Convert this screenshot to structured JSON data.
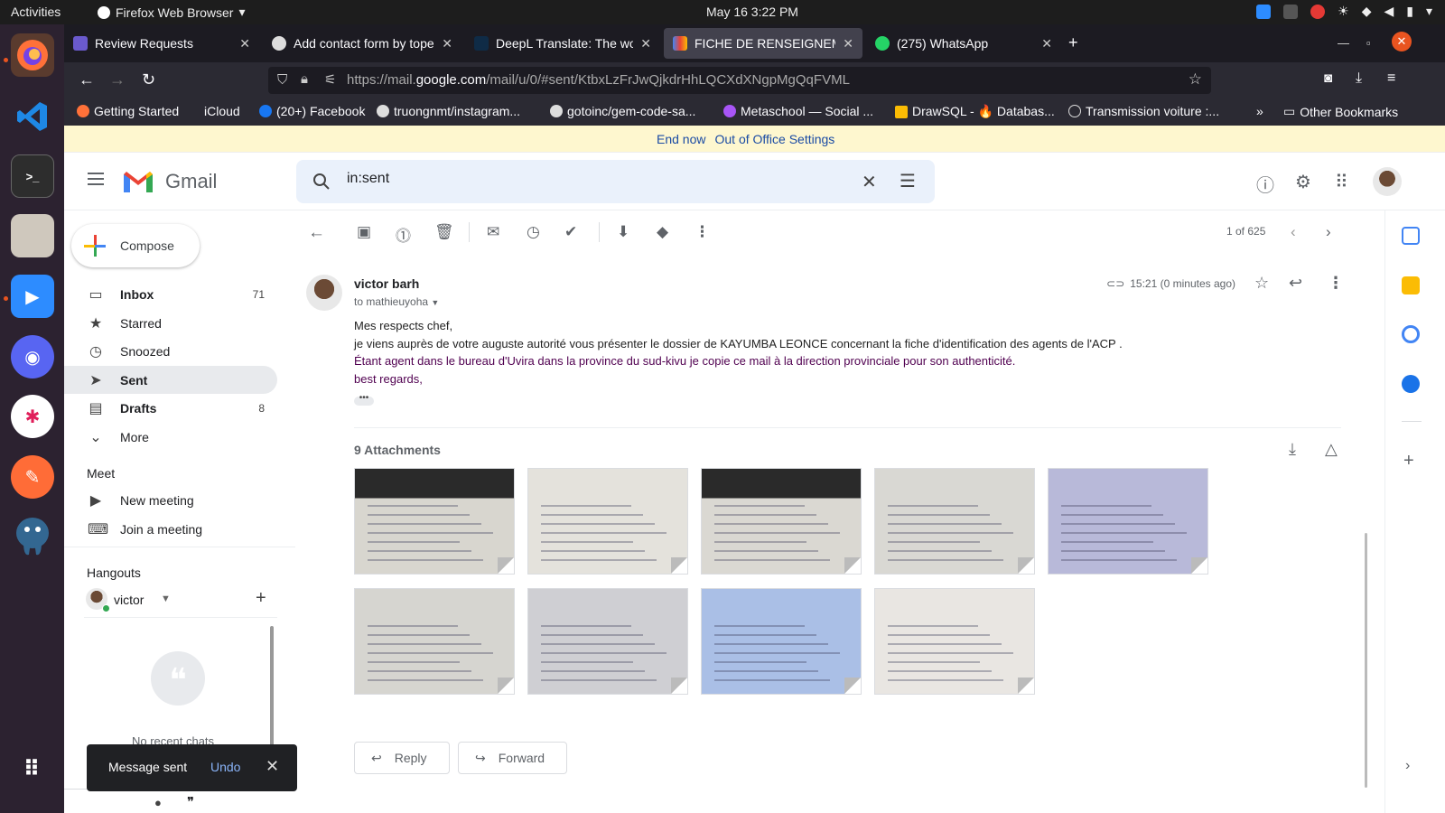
{
  "system": {
    "activities": "Activities",
    "app_name": "Firefox Web Browser",
    "datetime": "May 16  3:22 PM"
  },
  "browser": {
    "tabs": [
      {
        "title": "Review Requests",
        "active": false,
        "color": "#6a5acd"
      },
      {
        "title": "Add contact form by tope",
        "active": false,
        "color": "#dddddd"
      },
      {
        "title": "DeepL Translate: The wor",
        "active": false,
        "color": "#0f2b46"
      },
      {
        "title": "FICHE DE RENSEIGNEME",
        "active": true,
        "color": "#ea4335"
      },
      {
        "title": "(275) WhatsApp",
        "active": false,
        "color": "#25d366"
      }
    ],
    "url_prefix": "https://mail.",
    "url_domain": "google.com",
    "url_path": "/mail/u/0/#sent/KtbxLzFrJwQjkdrHhLQCXdXNgpMgQqFVML",
    "bookmarks": [
      {
        "label": "Getting Started",
        "color": "#ff7139"
      },
      {
        "label": "iCloud",
        "color": "#dddddd"
      },
      {
        "label": "(20+) Facebook",
        "color": "#1877f2"
      },
      {
        "label": "truongnmt/instagram...",
        "color": "#dddddd"
      },
      {
        "label": "gotoinc/gem-code-sa...",
        "color": "#dddddd"
      },
      {
        "label": "Metaschool — Social ...",
        "color": "#a855f7"
      },
      {
        "label": "DrawSQL - 🔥 Databas...",
        "color": "#fbbc04"
      },
      {
        "label": "Transmission voiture :...",
        "color": "#dddddd"
      }
    ],
    "other_bookmarks": "Other Bookmarks"
  },
  "gmail": {
    "ooo_end": "End now",
    "ooo_settings": "Out of Office Settings",
    "app_name": "Gmail",
    "search_value": "in:sent",
    "compose": "Compose",
    "nav": [
      {
        "label": "Inbox",
        "count": "71",
        "icon": "inbox-icon",
        "glyph": "▭",
        "active": false,
        "bold": true
      },
      {
        "label": "Starred",
        "count": "",
        "icon": "star-icon",
        "glyph": "★",
        "active": false,
        "bold": false
      },
      {
        "label": "Snoozed",
        "count": "",
        "icon": "clock-icon",
        "glyph": "◷",
        "active": false,
        "bold": false
      },
      {
        "label": "Sent",
        "count": "",
        "icon": "send-icon",
        "glyph": "➤",
        "active": true,
        "bold": true
      },
      {
        "label": "Drafts",
        "count": "8",
        "icon": "draft-icon",
        "glyph": "▤",
        "active": false,
        "bold": true
      },
      {
        "label": "More",
        "count": "",
        "icon": "chevron-down-icon",
        "glyph": "⌄",
        "active": false,
        "bold": false
      }
    ],
    "meet_title": "Meet",
    "meet_items": [
      {
        "label": "New meeting",
        "icon": "video-icon",
        "glyph": "▶"
      },
      {
        "label": "Join a meeting",
        "icon": "keyboard-icon",
        "glyph": "⌨"
      }
    ],
    "hangouts_title": "Hangouts",
    "hangouts_user": "victor",
    "no_chats": "No recent chats",
    "pagination": "1 of 625",
    "message": {
      "sender": "victor barh",
      "recipient": "to mathieuyoha",
      "time": "15:21 (0 minutes ago)",
      "body": [
        {
          "text": "Mes respects chef,",
          "purple": false
        },
        {
          "text": "je viens auprès de votre auguste autorité vous présenter le dossier de KAYUMBA LEONCE concernant la fiche d'identification des agents de l'ACP .",
          "purple": false
        },
        {
          "text": "Étant agent dans le bureau d'Uvira dans la province du sud-kivu je copie ce mail à la direction provinciale pour son authenticité.",
          "purple": true
        },
        {
          "text": "best regards,",
          "purple": true
        }
      ],
      "attachments_title": "9 Attachments",
      "attachments": [
        {
          "tone": "#d8d6cf",
          "dark_top": true
        },
        {
          "tone": "#e4e2dc",
          "dark_top": false
        },
        {
          "tone": "#dad8d2",
          "dark_top": true
        },
        {
          "tone": "#d9d8d3",
          "dark_top": false
        },
        {
          "tone": "#b8b9d9",
          "dark_top": false
        },
        {
          "tone": "#d6d5d0",
          "dark_top": false
        },
        {
          "tone": "#cfcfd3",
          "dark_top": false
        },
        {
          "tone": "#aabfe6",
          "dark_top": false
        },
        {
          "tone": "#e9e6e2",
          "dark_top": false
        }
      ],
      "reply": "Reply",
      "forward": "Forward"
    },
    "toast": {
      "text": "Message sent",
      "undo": "Undo"
    }
  }
}
